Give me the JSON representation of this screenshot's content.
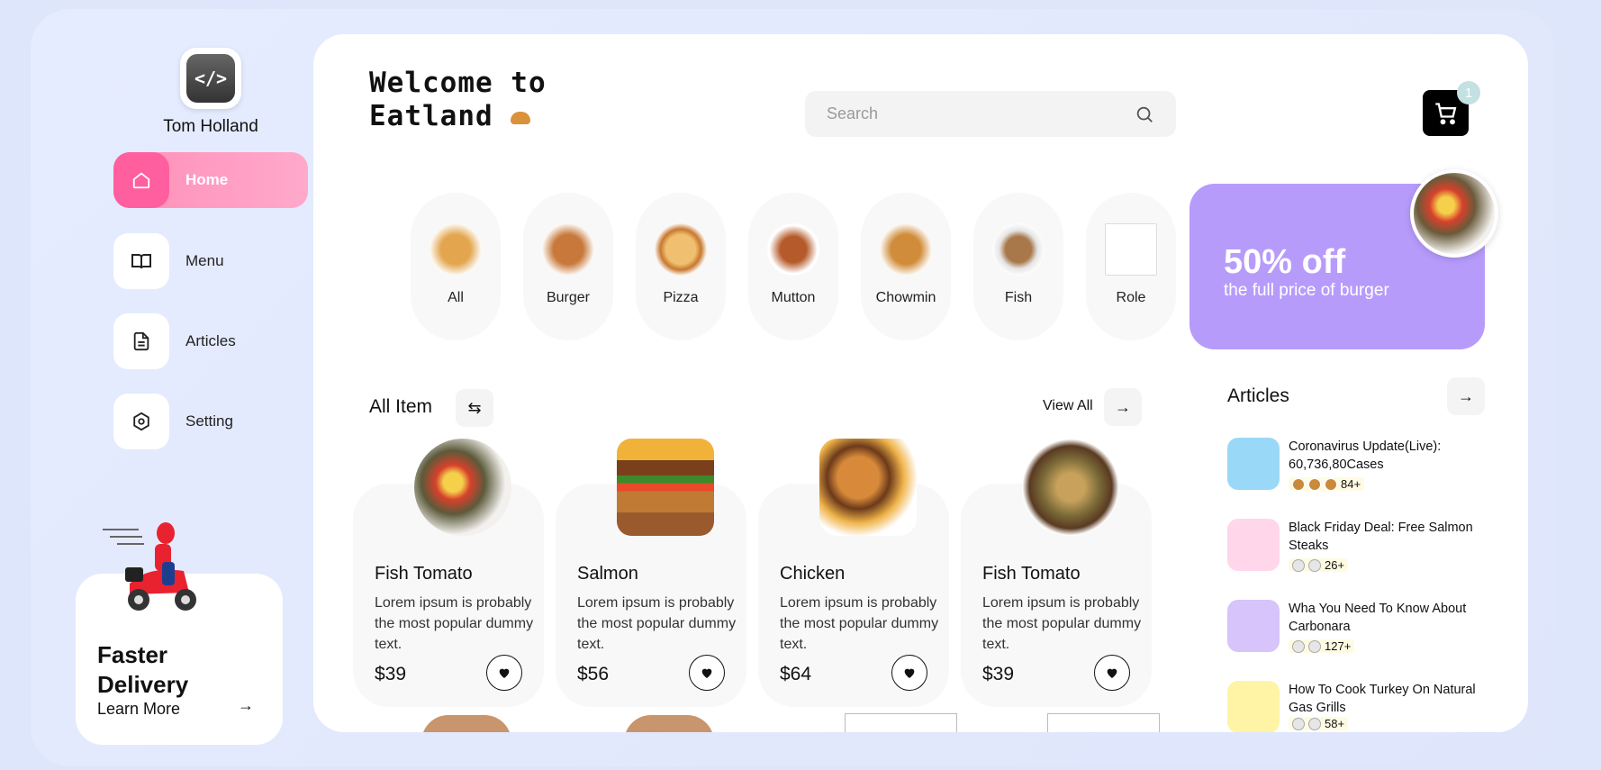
{
  "colors": {
    "accent": "#ff5f9e",
    "promo": "#b79bfb",
    "cart": "#000000",
    "badge": "#c3e0e2"
  },
  "sidebar": {
    "user_name": "Tom Holland",
    "items": [
      {
        "label": "Home",
        "icon": "home-icon",
        "active": true
      },
      {
        "label": "Menu",
        "icon": "book-icon",
        "active": false
      },
      {
        "label": "Articles",
        "icon": "document-icon",
        "active": false
      },
      {
        "label": "Setting",
        "icon": "settings-icon",
        "active": false
      }
    ],
    "delivery": {
      "title_line1": "Faster",
      "title_line2": "Delivery",
      "link": "Learn More"
    }
  },
  "header": {
    "welcome_line1": "Welcome to",
    "welcome_line2": "Eatland",
    "search_placeholder": "Search",
    "cart_count": "1"
  },
  "categories": [
    {
      "label": "All",
      "color": "#d79a4a"
    },
    {
      "label": "Burger",
      "color": "#c7783a"
    },
    {
      "label": "Pizza",
      "color": "#e0a55b"
    },
    {
      "label": "Mutton",
      "color": "#b55a2a"
    },
    {
      "label": "Chowmin",
      "color": "#d08c3a"
    },
    {
      "label": "Fish",
      "color": "#b08a5a"
    },
    {
      "label": "Role",
      "color": "#ffffff"
    }
  ],
  "promo": {
    "headline": "50% off",
    "subtext": "the full price of burger"
  },
  "items_section": {
    "title": "All Item",
    "view_all": "View All"
  },
  "items": [
    {
      "name": "Fish Tomato",
      "desc": "Lorem ipsum is probably the most popular dummy text.",
      "price": "$39",
      "color": "#cf7f45"
    },
    {
      "name": "Salmon",
      "desc": "Lorem ipsum is probably the most popular dummy text.",
      "price": "$56",
      "color": "#c06a32"
    },
    {
      "name": "Chicken",
      "desc": "Lorem ipsum is probably the most popular dummy text.",
      "price": "$64",
      "color": "#b9733a"
    },
    {
      "name": "Fish Tomato",
      "desc": "Lorem ipsum is probably the most popular dummy text.",
      "price": "$39",
      "color": "#8a6a40"
    }
  ],
  "articles_section": {
    "title": "Articles"
  },
  "articles": [
    {
      "title": "Coronavirus Update(Live): 60,736,80Cases",
      "count": "84+",
      "bg": "#9ad8f7"
    },
    {
      "title": "Black Friday Deal: Free Salmon Steaks",
      "count": "26+",
      "bg": "#ffd6ea"
    },
    {
      "title": "Wha You Need To Know About Carbonara",
      "count": "127+",
      "bg": "#d6c4fb"
    },
    {
      "title": "How To Cook Turkey On Natural Gas Grills",
      "count": "58+",
      "bg": "#fff3a6"
    }
  ]
}
